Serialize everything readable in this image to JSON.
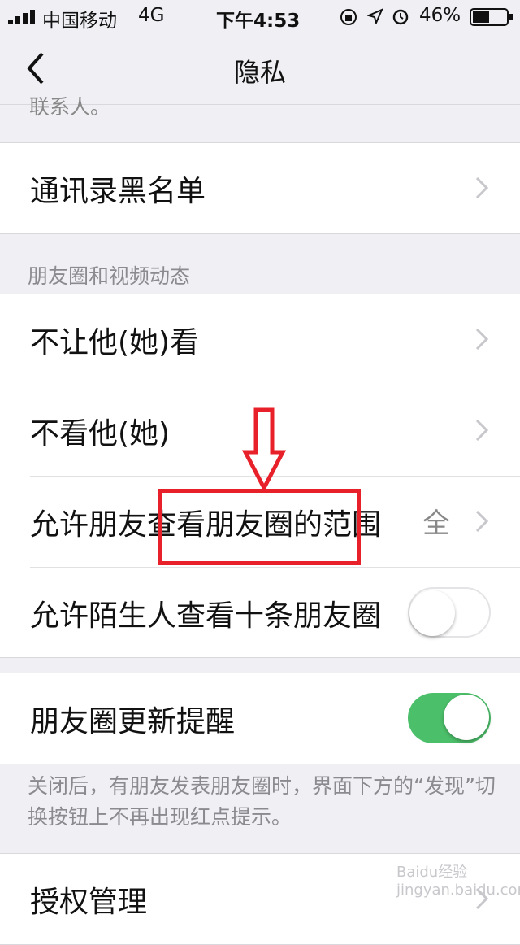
{
  "status_bar": {
    "carrier": "中国移动",
    "network": "4G",
    "time": "下午4:53",
    "battery": "46%"
  },
  "nav": {
    "title": "隐私"
  },
  "clipped_text": "联系人。",
  "rows": {
    "blacklist": "通讯录黑名单",
    "section_header": "朋友圈和视频动态",
    "hide_from": "不让他(她)看",
    "dont_see": "不看他(她)",
    "range": "允许朋友查看朋友圈的范围",
    "range_value": "全",
    "stranger": "允许陌生人查看十条朋友圈",
    "stranger_toggle": "off",
    "moments_update": "朋友圈更新提醒",
    "moments_update_toggle": "on",
    "moments_note": "关闭后，有朋友发表朋友圈时，界面下方的“发现”切换按钮上不再出现红点提示。",
    "auth": "授权管理"
  },
  "watermark": "Baidu经验 jingyan.baidu.com",
  "colors": {
    "toggle_on": "#4cbf6a",
    "annotation": "#e8202a",
    "background": "#efeff4"
  }
}
